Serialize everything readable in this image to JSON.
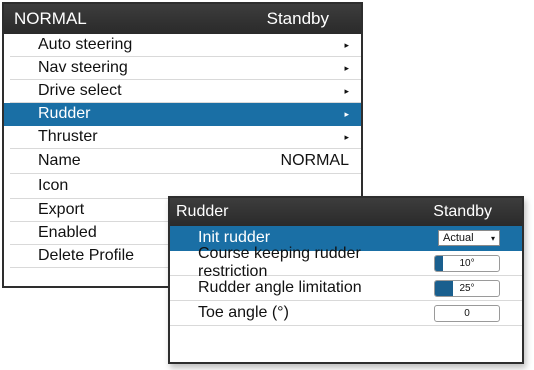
{
  "menu": {
    "title": "NORMAL",
    "status": "Standby",
    "items": [
      {
        "label": "Auto steering",
        "submenu": true
      },
      {
        "label": "Nav steering",
        "submenu": true
      },
      {
        "label": "Drive select",
        "submenu": true
      },
      {
        "label": "Rudder",
        "submenu": true,
        "selected": true
      },
      {
        "label": "Thruster",
        "submenu": true
      },
      {
        "label": "Name",
        "value": "NORMAL"
      },
      {
        "label": "Icon"
      },
      {
        "label": "Export"
      },
      {
        "label": "Enabled"
      },
      {
        "label": "Delete Profile"
      }
    ],
    "submenu_arrow": "▸"
  },
  "dialog": {
    "title": "Rudder",
    "status": "Standby",
    "rows": [
      {
        "label": "Init rudder",
        "control": "dropdown",
        "value": "Actual",
        "selected": true
      },
      {
        "label": "Course keeping rudder restriction",
        "control": "slider",
        "value": "10°",
        "fill_fraction": 0.12
      },
      {
        "label": "Rudder angle limitation",
        "control": "slider",
        "value": "25°",
        "fill_fraction": 0.28
      },
      {
        "label": "Toe angle (°)",
        "control": "number",
        "value": "0"
      }
    ],
    "dropdown_caret": "▾"
  },
  "colors": {
    "header_bg": "#2e2e2e",
    "selection": "#1a6fa5",
    "slider_fill": "#1a5f8e"
  }
}
